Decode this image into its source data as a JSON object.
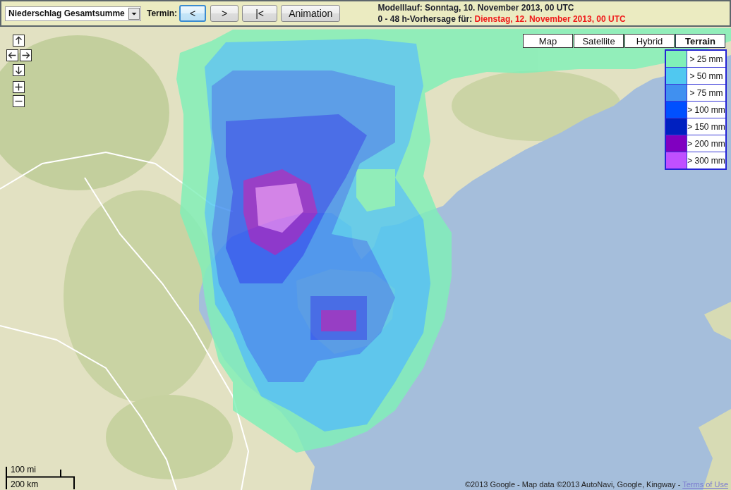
{
  "toolbar": {
    "product_select": {
      "value": "Niederschlag Gesamtsumme"
    },
    "termin_label": "Termin:",
    "buttons": [
      {
        "label": "<",
        "focused": true
      },
      {
        "label": ">",
        "focused": false
      },
      {
        "label": "|<",
        "focused": false
      },
      {
        "label": "Animation",
        "focused": false
      }
    ],
    "model_run": "Modelllauf: Sonntag, 10. November 2013, 00 UTC",
    "forecast": {
      "label": "0 - 48 h-Vorhersage für:",
      "value": "Dienstag, 12. November 2013, 00 UTC"
    }
  },
  "map": {
    "map_types": [
      {
        "label": "Map",
        "selected": false
      },
      {
        "label": "Satellite",
        "selected": false
      },
      {
        "label": "Hybrid",
        "selected": false
      },
      {
        "label": "Terrain",
        "selected": true
      }
    ],
    "legend": [
      {
        "label": "> 25 mm",
        "color": "#80f0b8"
      },
      {
        "label": "> 50 mm",
        "color": "#50c8f0"
      },
      {
        "label": "> 75 mm",
        "color": "#4090f0"
      },
      {
        "label": "> 100 mm",
        "color": "#0050ff"
      },
      {
        "label": "> 150 mm",
        "color": "#0020c0"
      },
      {
        "label": "> 200 mm",
        "color": "#8000c0"
      },
      {
        "label": "> 300 mm",
        "color": "#c050ff"
      }
    ],
    "scale": {
      "imperial": "100 mi",
      "metric": "200 km"
    },
    "attribution": {
      "text": "©2013 Google - Map data ©2013 AutoNavi, Google, Kingway -",
      "link": "Terms of Use"
    }
  }
}
